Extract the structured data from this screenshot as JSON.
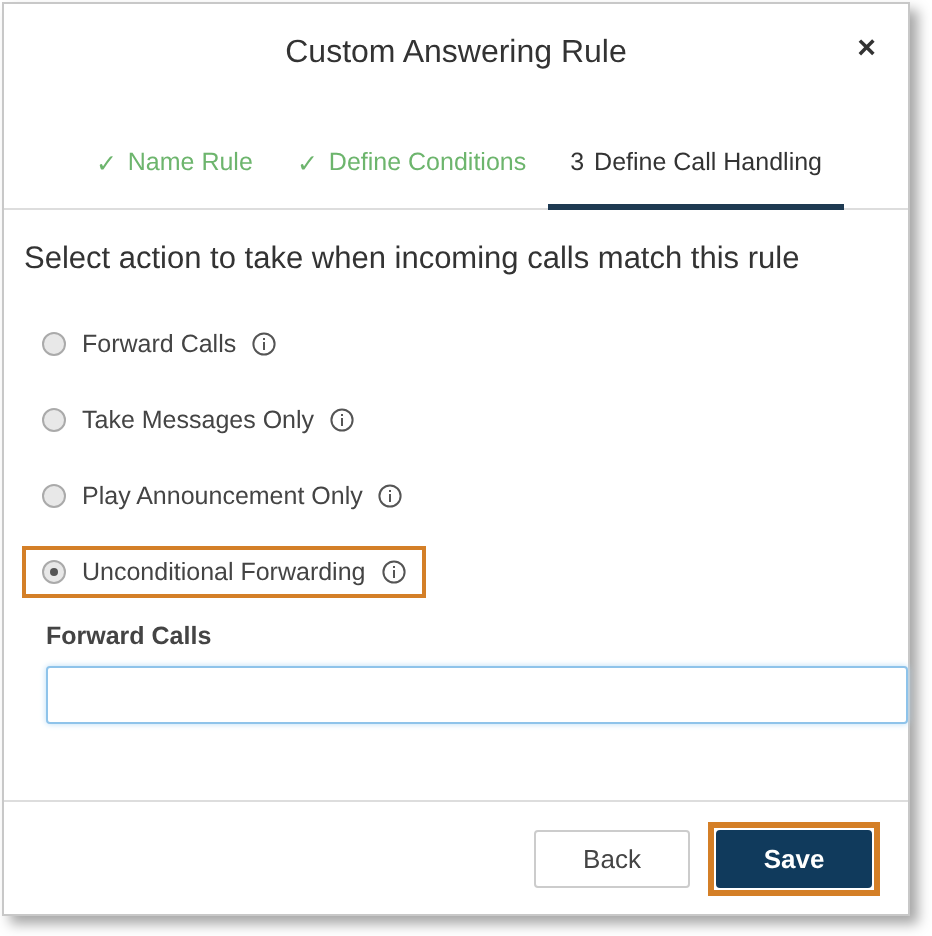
{
  "dialog": {
    "title": "Custom Answering Rule",
    "close": "×"
  },
  "steps": [
    {
      "number": "✓",
      "label": "Name Rule",
      "done": true,
      "selected": false
    },
    {
      "number": "✓",
      "label": "Define Conditions",
      "done": true,
      "selected": false
    },
    {
      "number": "3",
      "label": "Define Call Handling",
      "done": false,
      "selected": true
    }
  ],
  "heading": "Select action to take when incoming calls match this rule",
  "options": [
    {
      "label": "Forward Calls",
      "selected": false,
      "highlighted": false
    },
    {
      "label": "Take Messages Only",
      "selected": false,
      "highlighted": false
    },
    {
      "label": "Play Announcement Only",
      "selected": false,
      "highlighted": false
    },
    {
      "label": "Unconditional Forwarding",
      "selected": true,
      "highlighted": true
    }
  ],
  "field": {
    "label": "Forward Calls"
  },
  "buttons": [
    {
      "label": "Back",
      "kind": "secondary",
      "highlighted": false
    },
    {
      "label": "Save",
      "kind": "primary",
      "highlighted": true
    }
  ]
}
